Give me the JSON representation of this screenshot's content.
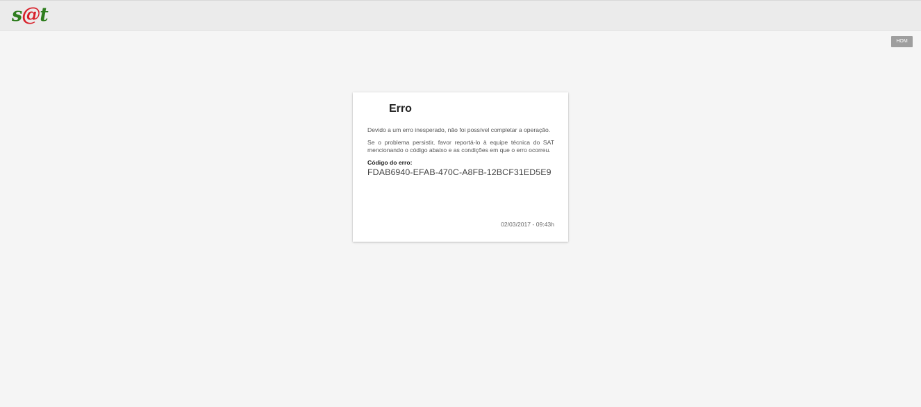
{
  "header": {
    "logo": {
      "s": "s",
      "at": "@",
      "t": "t"
    },
    "env_badge": "HOM"
  },
  "error_card": {
    "title": "Erro",
    "message_1": "Devido a um erro inesperado, não foi possível completar a operação.",
    "message_2": "Se o problema persistir, favor reportá-lo à equipe técnica do SAT mencionando o código abaixo e as condições em que o erro ocorreu.",
    "code_label": "Código do erro:",
    "code_value": "FDAB6940-EFAB-470C-A8FB-12BCF31ED5E9",
    "timestamp": "02/03/2017 - 09:43h"
  },
  "colors": {
    "logo_green": "#2e7d1e",
    "logo_red": "#d8202a",
    "badge_gray": "#9e9e9e",
    "page_bg": "#f5f5f5"
  }
}
